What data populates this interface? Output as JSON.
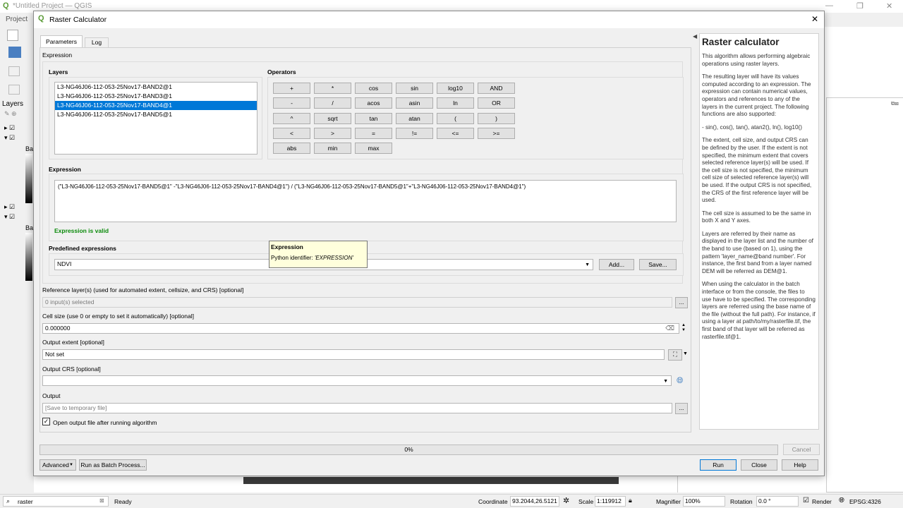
{
  "main_window": {
    "title": "*Untitled Project — QGIS",
    "menu_first": "Project",
    "layers_panel_title": "Layers",
    "layer_label_a": "Ba",
    "layer_label_b": "Ba"
  },
  "dialog": {
    "title": "Raster Calculator",
    "tabs": [
      {
        "label": "Parameters"
      },
      {
        "label": "Log"
      }
    ],
    "section_label": "Expression"
  },
  "layers_group": {
    "title": "Layers",
    "items": [
      "L3-NG46J06-112-053-25Nov17-BAND2@1",
      "L3-NG46J06-112-053-25Nov17-BAND3@1",
      "L3-NG46J06-112-053-25Nov17-BAND4@1",
      "L3-NG46J06-112-053-25Nov17-BAND5@1"
    ],
    "selected_index": 2
  },
  "operators": {
    "title": "Operators",
    "rows": [
      [
        "+",
        "*",
        "cos",
        "sin",
        "log10",
        "AND"
      ],
      [
        "-",
        "/",
        "acos",
        "asin",
        "ln",
        "OR"
      ],
      [
        "^",
        "sqrt",
        "tan",
        "atan",
        "(",
        ")"
      ],
      [
        "<",
        ">",
        "=",
        "!=",
        "<=",
        ">="
      ],
      [
        "abs",
        "min",
        "max"
      ]
    ]
  },
  "expression_group": {
    "title": "Expression",
    "text": "(\"L3-NG46J06-112-053-25Nov17-BAND5@1\" -\"L3-NG46J06-112-053-25Nov17-BAND4@1\") / (\"L3-NG46J06-112-053-25Nov17-BAND5@1\"+\"L3-NG46J06-112-053-25Nov17-BAND4@1\")",
    "status": "Expression is valid",
    "status_color": "#0a8a0a"
  },
  "predefined": {
    "title": "Predefined expressions",
    "selected": "NDVI",
    "add_label": "Add...",
    "save_label": "Save..."
  },
  "tooltip": {
    "title": "Expression",
    "prefix": "Python identifier: ",
    "value": "'EXPRESSION'"
  },
  "params": {
    "reference_label": "Reference layer(s) (used for automated extent, cellsize, and CRS) [optional]",
    "reference_value": "0 input(s) selected",
    "cellsize_label": "Cell size (use 0 or empty to set it automatically) [optional]",
    "cellsize_value": "0.000000",
    "extent_label": "Output extent [optional]",
    "extent_value": "Not set",
    "crs_label": "Output CRS [optional]",
    "crs_value": "",
    "output_label": "Output",
    "output_placeholder": "[Save to temporary file]",
    "ellipsis": "...",
    "open_after_label": "Open output file after running algorithm",
    "open_after_checked": true
  },
  "progress": {
    "value": 0,
    "text": "0%",
    "cancel_label": "Cancel"
  },
  "footer": {
    "advanced_label": "Advanced",
    "batch_label": "Run as Batch Process...",
    "run_label": "Run",
    "close_label": "Close",
    "help_label": "Help"
  },
  "help": {
    "title": "Raster calculator",
    "paragraphs": [
      "This algorithm allows performing algebraic operations using raster layers.",
      "The resulting layer will have its values computed according to an expression. The expression can contain numerical values, operators and references to any of the layers in the current project. The following functions are also supported:",
      "- sin(), cos(), tan(), atan2(), ln(), log10()",
      "The extent, cell size, and output CRS can be defined by the user. If the extent is not specified, the minimum extent that covers selected reference layer(s) will be used. If the cell size is not specified, the minimum cell size of selected reference layer(s) will be used. If the output CRS is not specified, the CRS of the first reference layer will be used.",
      "The cell size is assumed to be the same in both X and Y axes.",
      "Layers are referred by their name as displayed in the layer list and the number of the band to use (based on 1), using the pattern 'layer_name@band number'. For instance, the first band from a layer named DEM will be referred as DEM@1.",
      "When using the calculator in the batch interface or from the console, the files to use have to be specified. The corresponding layers are referred using the base name of the file (without the full path). For instance, if using a layer at path/to/my/rasterfile.tif, the first band of that layer will be referred as rasterfile.tif@1."
    ]
  },
  "statusbar": {
    "search_value": "raster",
    "ready": "Ready",
    "coordinate_label": "Coordinate",
    "coordinate_value": "93.2044,26.5121",
    "scale_label": "Scale",
    "scale_value": "1:119912",
    "magnifier_label": "Magnifier",
    "magnifier_value": "100%",
    "rotation_label": "Rotation",
    "rotation_value": "0.0 °",
    "render_label": "Render",
    "render_checked": true,
    "crs": "EPSG:4326"
  },
  "colors": {
    "selection": "#0078d7",
    "accent_green": "#0a8a0a",
    "tooltip_bg": "#ffffdc"
  }
}
